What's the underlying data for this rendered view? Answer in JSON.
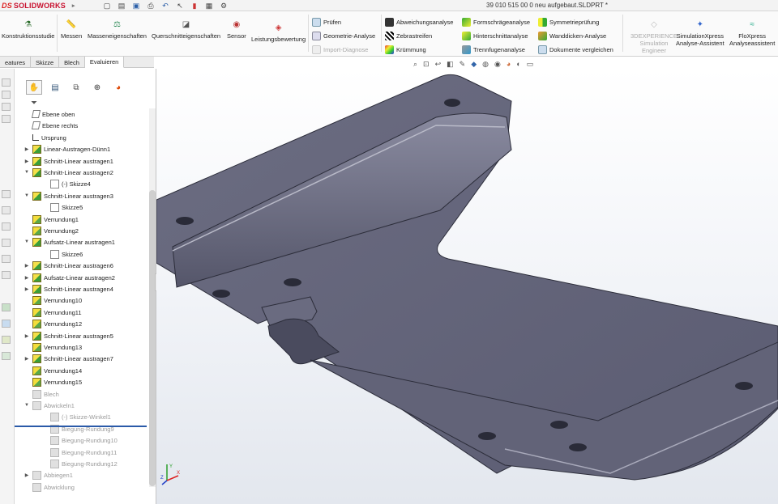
{
  "app": {
    "logo_ds": "DS",
    "logo_name": "SOLIDWORKS"
  },
  "document": {
    "title": "39 010 515 00 0 neu aufgebaut.SLDPRT *"
  },
  "ribbon": {
    "konstruktionsstudie": "Konstruktionsstudie",
    "messen": "Messen",
    "masseeigenschaften": "Masseneigenschaften",
    "querschnitt": "Querschnitteigenschaften",
    "sensor": "Sensor",
    "leistung": "Leistungsbewertung",
    "pruefen": "Prüfen",
    "geometrie": "Geometrie-Analyse",
    "import": "Import-Diagnose",
    "abweichung": "Abweichungsanalyse",
    "zebra": "Zebrastreifen",
    "kruemmung": "Krümmung",
    "formschraege": "Formschrägeanalyse",
    "hinterschnitt": "Hinterschnittanalyse",
    "trennfugen": "Trennfugenanalyse",
    "symmetrie": "Symmetrieprüfung",
    "wanddicken": "Wanddicken-Analyse",
    "dokumente": "Dokumente vergleichen",
    "experience_1": "3DEXPERIENCE",
    "experience_2": "Simulation",
    "experience_3": "Engineer",
    "simxpress_1": "SimulationXpress",
    "simxpress_2": "Analyse-Assistent",
    "floxpress_1": "FloXpress",
    "floxpress_2": "Analyseassistent"
  },
  "command_tabs": [
    "eatures",
    "Skizze",
    "Blech",
    "Evaluieren"
  ],
  "tree": [
    {
      "label": "Ebene oben"
    },
    {
      "label": "Ebene rechts"
    },
    {
      "label": "Ursprung"
    },
    {
      "label": "Linear-Austragen-Dünn1"
    },
    {
      "label": "Schnitt-Linear austragen1"
    },
    {
      "label": "Schnitt-Linear austragen2"
    },
    {
      "label": "(-) Skizze4"
    },
    {
      "label": "Schnitt-Linear austragen3"
    },
    {
      "label": "Skizze5"
    },
    {
      "label": "Verrundung1"
    },
    {
      "label": "Verrundung2"
    },
    {
      "label": "Aufsatz-Linear austragen1"
    },
    {
      "label": "Skizze6"
    },
    {
      "label": "Schnitt-Linear austragen6"
    },
    {
      "label": "Aufsatz-Linear austragen2"
    },
    {
      "label": "Schnitt-Linear austragen4"
    },
    {
      "label": "Verrundung10"
    },
    {
      "label": "Verrundung11"
    },
    {
      "label": "Verrundung12"
    },
    {
      "label": "Schnitt-Linear austragen5"
    },
    {
      "label": "Verrundung13"
    },
    {
      "label": "Schnitt-Linear austragen7"
    },
    {
      "label": "Verrundung14"
    },
    {
      "label": "Verrundung15"
    },
    {
      "label": "Blech"
    },
    {
      "label": "Abwickeln1"
    },
    {
      "label": "(-) Skizze-Winkel1"
    },
    {
      "label": "Biegung-Rundung9"
    },
    {
      "label": "Biegung-Rundung10"
    },
    {
      "label": "Biegung-Rundung11"
    },
    {
      "label": "Biegung-Rundung12"
    },
    {
      "label": "Abbiegen1"
    },
    {
      "label": "Abwicklung"
    }
  ],
  "triad": {
    "y": "Y",
    "x": "X",
    "z": "Z"
  }
}
